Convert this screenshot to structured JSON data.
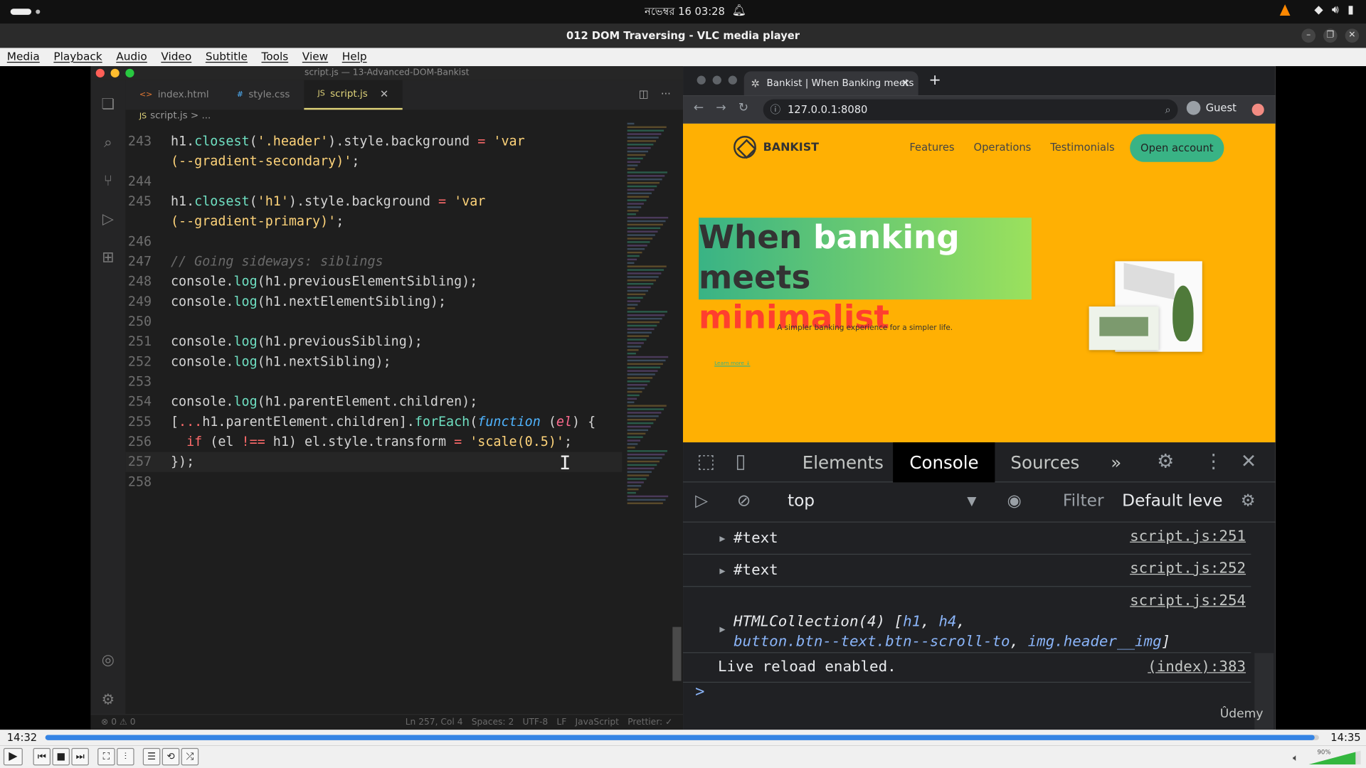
{
  "system": {
    "clock": "নভেম্বর 16  03:28"
  },
  "window": {
    "title": "012 DOM Traversing - VLC media player"
  },
  "menu": [
    "Media",
    "Playback",
    "Audio",
    "Video",
    "Subtitle",
    "Tools",
    "View",
    "Help"
  ],
  "vscode": {
    "title": "script.js — 13-Advanced-DOM-Bankist",
    "tabs": [
      {
        "icon": "<>",
        "label": "index.html"
      },
      {
        "icon": "#",
        "label": "style.css"
      },
      {
        "icon": "JS",
        "label": "script.js"
      }
    ],
    "breadcrumb": "script.js > ...",
    "code": [
      {
        "ln": "243",
        "html": "h1.<span class='f'>closest</span>(<span class='s'>'.header'</span>).style.background <span class='k'>=</span> <span class='s'>'var</span>"
      },
      {
        "ln": "",
        "html": "<span class='s'>(--gradient-secondary)'</span>;"
      },
      {
        "ln": "244",
        "html": ""
      },
      {
        "ln": "245",
        "html": "h1.<span class='f'>closest</span>(<span class='s'>'h1'</span>).style.background <span class='k'>=</span> <span class='s'>'var</span>"
      },
      {
        "ln": "",
        "html": "<span class='s'>(--gradient-primary)'</span>;"
      },
      {
        "ln": "246",
        "html": ""
      },
      {
        "ln": "247",
        "html": "<span class='c'>// Going sideways: siblings</span>"
      },
      {
        "ln": "248",
        "html": "console.<span class='f'>log</span>(h1.previousElementSibling);"
      },
      {
        "ln": "249",
        "html": "console.<span class='f'>log</span>(h1.nextElementSibling);"
      },
      {
        "ln": "250",
        "html": ""
      },
      {
        "ln": "251",
        "html": "console.<span class='f'>log</span>(h1.previousSibling);"
      },
      {
        "ln": "252",
        "html": "console.<span class='f'>log</span>(h1.nextSibling);"
      },
      {
        "ln": "253",
        "html": ""
      },
      {
        "ln": "254",
        "html": "console.<span class='f'>log</span>(h1.parentElement.children);"
      },
      {
        "ln": "255",
        "html": "[<span class='k'>...</span>h1.parentElement.children].<span class='f'>forEach</span>(<span class='kw'>function</span> (<span class='p'>el</span>) {"
      },
      {
        "ln": "256",
        "html": "  <span class='k'>if</span> (el <span class='k'>!==</span> h1) el.style.transform <span class='k'>=</span> <span class='s'>'scale(0.5)'</span>;"
      },
      {
        "ln": "257",
        "html": "});"
      },
      {
        "ln": "258",
        "html": ""
      }
    ],
    "status_left": "⊗ 0 ⚠ 0",
    "status_right": [
      "Ln 257, Col 4",
      "Spaces: 2",
      "UTF-8",
      "LF",
      "JavaScript",
      "Prettier: ✓"
    ]
  },
  "browser": {
    "tab_title": "Bankist | When Banking meets",
    "url": "127.0.0.1:8080",
    "profile": "Guest",
    "page": {
      "logo": "BANKIST",
      "nav": [
        "Features",
        "Operations",
        "Testimonials"
      ],
      "cta": "Open account",
      "headline_part1": "When ",
      "headline_part2": "banking",
      "headline_part3": " meets",
      "headline_line2": "minimalist",
      "subtitle": "A simpler banking experience for a simpler life.",
      "learn_more": "Learn more ↓"
    }
  },
  "devtools": {
    "tabs": [
      "Elements",
      "Console",
      "Sources",
      "»"
    ],
    "context": "top",
    "filter_placeholder": "Filter",
    "level": "Default leve",
    "rows": [
      {
        "text": "#text",
        "link": "script.js:251"
      },
      {
        "text": "#text",
        "link": "script.js:252"
      },
      {
        "link": "script.js:254"
      },
      {
        "text": "Live reload enabled.",
        "link": "(index):383"
      }
    ],
    "collection_prefix": "HTMLCollection(4) [",
    "collection_items": [
      "h1",
      "h4",
      "button.btn--text.btn--scroll-to",
      "img.header__img"
    ],
    "watermark": "Ûdemy"
  },
  "player": {
    "elapsed": "14:32",
    "total": "14:35",
    "progress_fraction": 0.9966,
    "volume": "90%",
    "volume_fraction": 0.9
  }
}
